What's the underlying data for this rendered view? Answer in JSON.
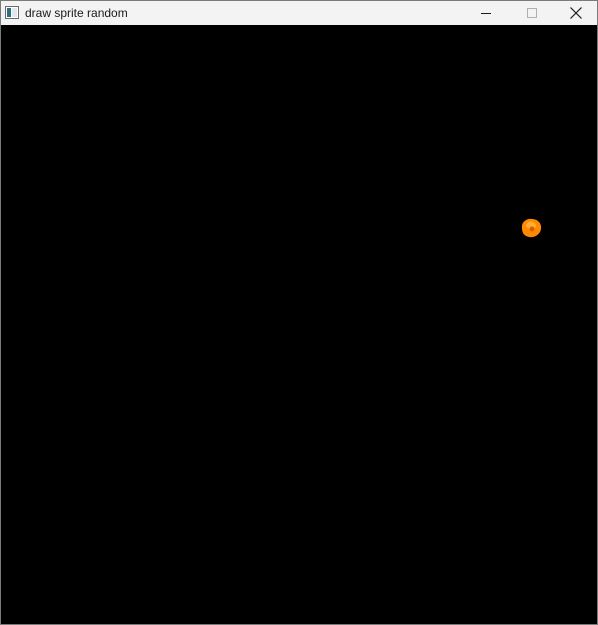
{
  "window": {
    "title": "draw sprite random",
    "background_color": "#000000"
  },
  "titlebar": {
    "background_color": "#f3f3f3",
    "buttons": {
      "minimize_icon": "minimize-icon",
      "maximize_icon": "maximize-icon",
      "close_icon": "close-icon"
    }
  },
  "sprite": {
    "icon": "orange-blob-sprite",
    "color": "#ff8a00",
    "highlight_color": "#ffb13b",
    "core_color": "#e25a00"
  }
}
